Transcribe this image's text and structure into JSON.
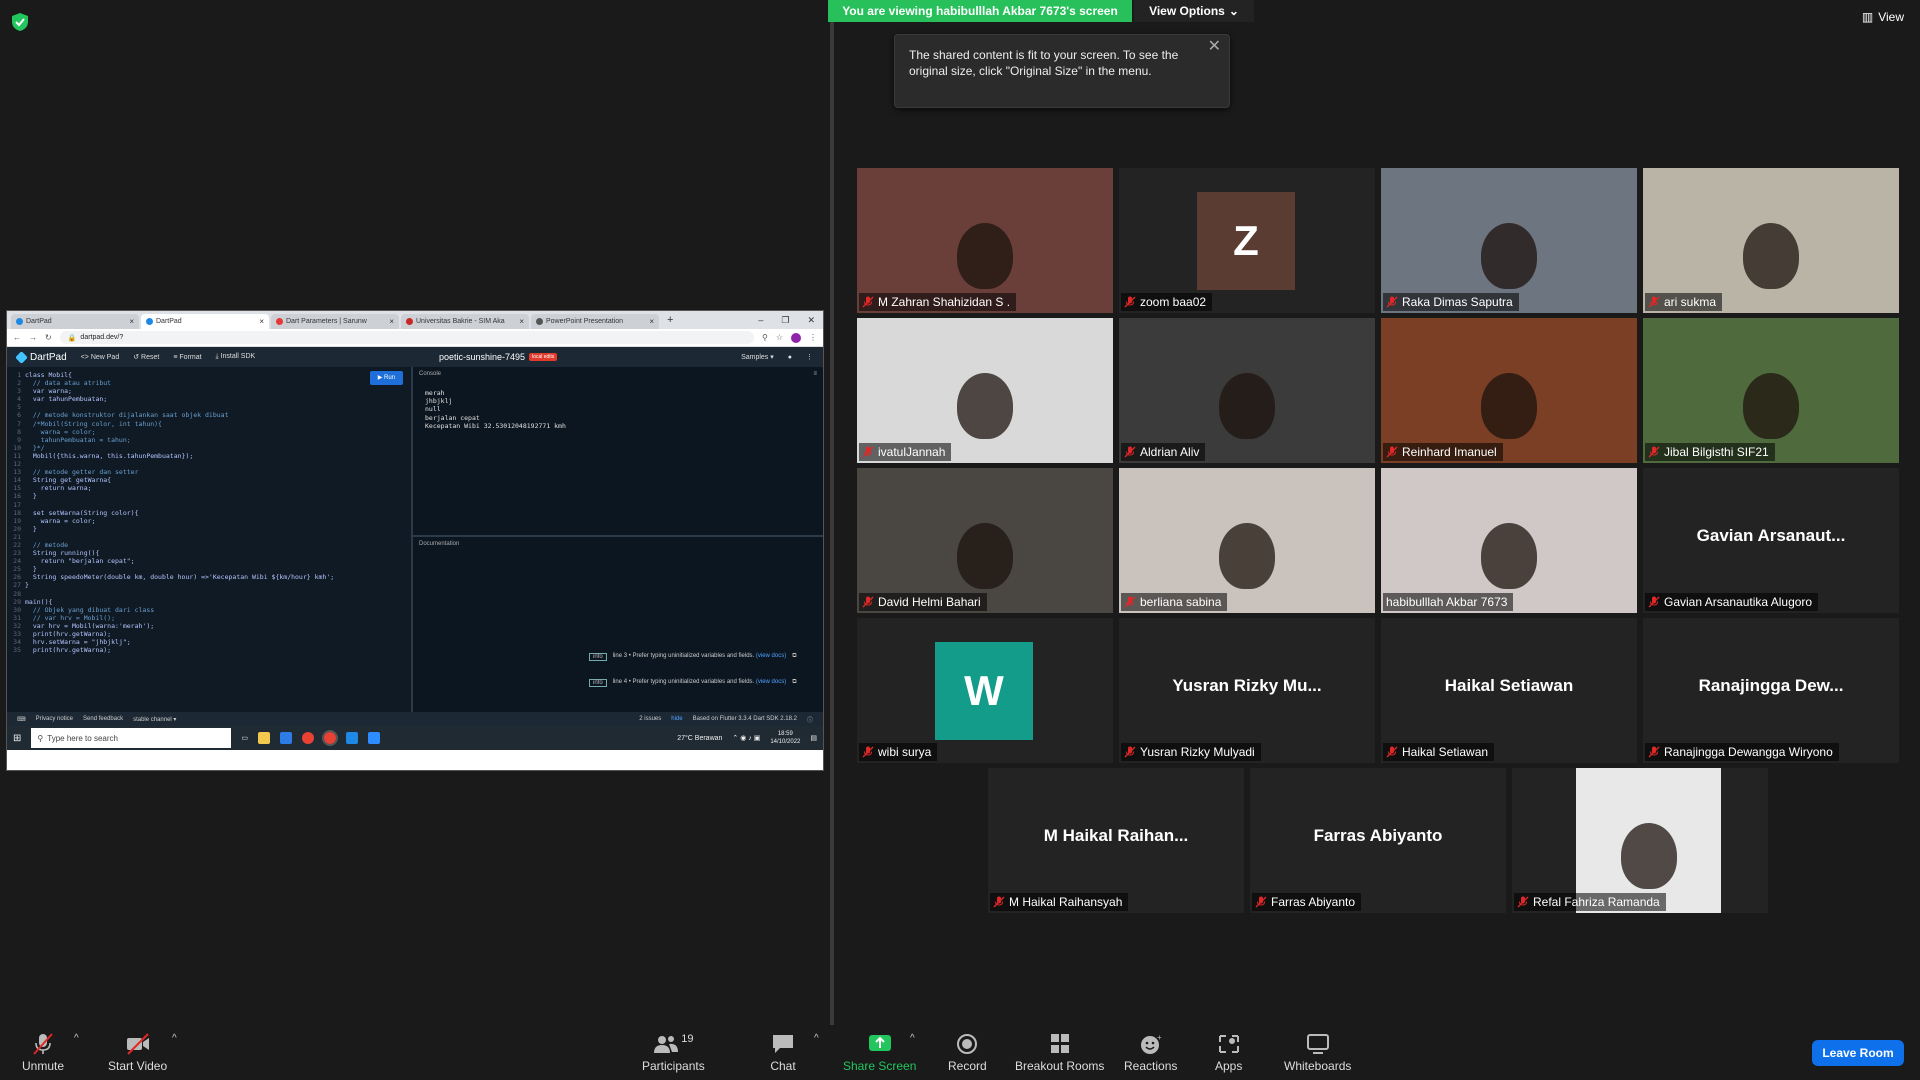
{
  "banner": {
    "viewing": "You are viewing habibulllah Akbar 7673's screen",
    "view_options": "View Options",
    "view": "View"
  },
  "tooltip": {
    "text": "The shared content is fit to your screen. To see the original size, click \"Original Size\" in the menu."
  },
  "shared_screen": {
    "tabs": [
      "DartPad",
      "DartPad",
      "Dart Parameters | Sarunw",
      "Universitas Bakrie - SIM Aka",
      "PowerPoint Presentation"
    ],
    "url": "dartpad.dev/?",
    "header": {
      "logo": "DartPad",
      "new_pad": "New Pad",
      "reset": "Reset",
      "format": "Format",
      "install_sdk": "Install SDK",
      "pad_name": "poetic-sunshine-7495",
      "pad_badge": "local edits",
      "samples": "Samples"
    },
    "run_label": "Run",
    "code": [
      "class Mobil{",
      "  // data atau atribut",
      "  var warna;",
      "  var tahunPembuatan;",
      "",
      "  // metode konstruktor dijalankan saat objek dibuat",
      "  /*Mobil(String color, int tahun){",
      "    warna = color;",
      "    tahunPembuatan = tahun;",
      "  }*/",
      "  Mobil({this.warna, this.tahunPembuatan});",
      "",
      "  // metode getter dan setter",
      "  String get getWarna{",
      "    return warna;",
      "  }",
      "",
      "  set setWarna(String color){",
      "    warna = color;",
      "  }",
      "",
      "  // metode",
      "  String running(){",
      "    return \"berjalan cepat\";",
      "  }",
      "  String speedoMeter(double km, double hour) =>'Kecepatan Wibi ${km/hour} kmh';",
      "}",
      "",
      "main(){",
      "  // Objek yang dibuat dari class",
      "  // var hrv = Mobil();",
      "  var hrv = Mobil(warna:'merah');",
      "  print(hrv.getWarna);",
      "  hrv.setWarna = \"jhbjklj\";",
      "  print(hrv.getWarna);"
    ],
    "console_label": "Console",
    "console_output": [
      "merah",
      "jhbjklj",
      "null",
      "berjalan cepat",
      "Kecepatan Wibi 32.53012048192771 kmh"
    ],
    "documentation_label": "Documentation",
    "issues": [
      {
        "tag": "info",
        "text": "line 3 • Prefer typing uninitialized variables and fields.",
        "link": "(view docs)"
      },
      {
        "tag": "info",
        "text": "line 4 • Prefer typing uninitialized variables and fields.",
        "link": "(view docs)"
      }
    ],
    "footer": {
      "privacy": "Privacy notice",
      "feedback": "Send feedback",
      "channel": "stable channel",
      "issues_count": "2 issues",
      "hide": "hide",
      "sdk": "Based on Flutter 3.3.4 Dart SDK 2.18.2"
    },
    "taskbar": {
      "search_placeholder": "Type here to search",
      "weather": "27°C  Berawan",
      "time": "18:59",
      "date": "14/10/2022"
    }
  },
  "participants_tiles": [
    {
      "name": "M Zahran Shahizidan S .",
      "type": "video",
      "color": "#6a3f3a"
    },
    {
      "name": "zoom baa02",
      "type": "avatar",
      "letter": "Z",
      "color": "#5a3c33"
    },
    {
      "name": "Raka Dimas Saputra",
      "type": "video",
      "color": "#6d7580"
    },
    {
      "name": "ari sukma",
      "type": "video",
      "color": "#b9b4a6"
    },
    {
      "name": "ivatulJannah",
      "type": "video",
      "color": "#d9d9d9"
    },
    {
      "name": "Aldrian Aliv",
      "type": "video",
      "color": "#3b3b3b"
    },
    {
      "name": "Reinhard Imanuel",
      "type": "video",
      "color": "#7a3f25"
    },
    {
      "name": "Jibal Bilgisthi SIF21",
      "type": "video",
      "color": "#4f6a3d"
    },
    {
      "name": "David Helmi Bahari",
      "type": "video",
      "color": "#4a4642"
    },
    {
      "name": "berliana sabina",
      "type": "video",
      "color": "#c9c2bd"
    },
    {
      "name": "habibulllah Akbar 7673",
      "type": "video",
      "color": "#cfc8c6",
      "active": true
    },
    {
      "name": "Gavian Arsanautika Alugoro",
      "type": "name",
      "big": "Gavian  Arsanaut..."
    },
    {
      "name": "wibi surya",
      "type": "avatar",
      "letter": "W",
      "color": "#139c8a"
    },
    {
      "name": "Yusran Rizky Mulyadi",
      "type": "name",
      "big": "Yusran Rizky Mu..."
    },
    {
      "name": "Haikal Setiawan",
      "type": "name",
      "big": "Haikal Setiawan"
    },
    {
      "name": "Ranajingga Dewangga Wiryono",
      "type": "name",
      "big": "Ranajingga  Dew..."
    },
    {
      "name": "M Haikal Raihansyah",
      "type": "name",
      "big": "M  Haikal  Raihan..."
    },
    {
      "name": "Farras Abiyanto",
      "type": "name",
      "big": "Farras Abiyanto"
    },
    {
      "name": "Refal Fahriza Ramanda",
      "type": "photo",
      "color": "#e8e8e8"
    }
  ],
  "toolbar": {
    "unmute": "Unmute",
    "start_video": "Start Video",
    "participants": "Participants",
    "participants_count": "19",
    "chat": "Chat",
    "share_screen": "Share Screen",
    "record": "Record",
    "breakout_rooms": "Breakout Rooms",
    "reactions": "Reactions",
    "apps": "Apps",
    "whiteboards": "Whiteboards",
    "leave": "Leave Room"
  },
  "colors": {
    "banner_green": "#27c05a",
    "active_speaker": "#e3e34a",
    "leave_blue": "#0e71eb",
    "share_green": "#22c55e",
    "mute_red": "#e02828"
  }
}
